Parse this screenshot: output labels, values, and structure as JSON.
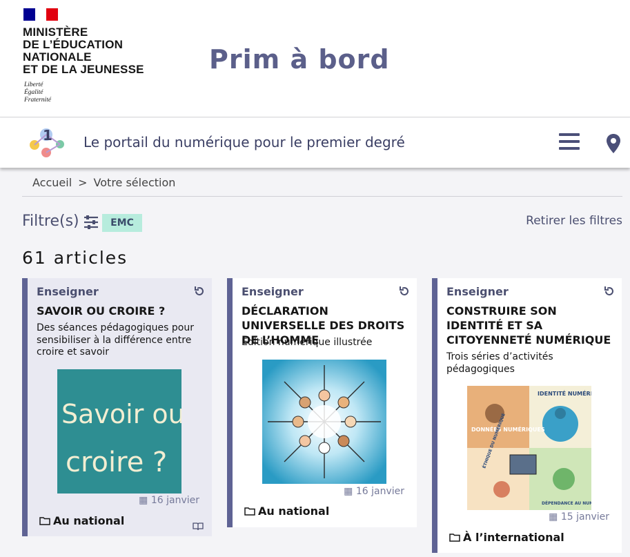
{
  "header": {
    "ministry_lines": [
      "MINISTÈRE",
      "DE L’ÉDUCATION",
      "NATIONALE",
      "ET DE LA JEUNESSE"
    ],
    "motto": [
      "Liberté",
      "Égalité",
      "Fraternité"
    ],
    "site_title": "Prim à bord",
    "tagline": "Le portail du numérique pour le premier degré",
    "logo_digit": "1"
  },
  "breadcrumb": {
    "home": "Accueil",
    "separator": ">",
    "current": "Votre sélection"
  },
  "filters": {
    "label": "Filtre(s)",
    "chip": "EMC",
    "remove": "Retirer les filtres"
  },
  "results": {
    "count": "61 articles"
  },
  "cards": [
    {
      "category": "Enseigner",
      "title": "SAVOIR OU CROIRE ?",
      "description": "Des séances pédagogiques pour sensibiliser à la différence entre croire et savoir",
      "image_text_1": "Savoir ou",
      "image_text_2": "croire ?",
      "date": "16 janvier",
      "location": "Au national"
    },
    {
      "category": "Enseigner",
      "title": "DÉCLARATION UNIVERSELLE DES DROITS DE L’HOMME",
      "description": "Edition numérique illustrée",
      "date": "16 janvier",
      "location": "Au national"
    },
    {
      "category": "Enseigner",
      "title": "CONSTRUIRE SON IDENTITÉ ET SA CITOYENNETÉ NUMÉRIQUE",
      "description": "Trois séries d’activités pédagogiques",
      "image_labels": [
        "IDENTITÉ NUMÉRIQUE",
        "DONNÉES NUMÉRIQUES",
        "ÉTHIQUE DU NUMÉRIQUE",
        "DÉPENDANCE AU NUMÉRIQUE"
      ],
      "date": "15 janvier",
      "location": "À l’international"
    }
  ],
  "colors": {
    "accent": "#5f6394",
    "title": "#5b5f8a",
    "chip_bg": "#b7ecdd",
    "flag_blue": "#000091",
    "flag_red": "#e1000f"
  },
  "icons": [
    "refresh-icon",
    "calendar-icon",
    "folder-icon",
    "book-icon",
    "menu-icon",
    "location-pin-icon",
    "filter-sliders-icon"
  ]
}
